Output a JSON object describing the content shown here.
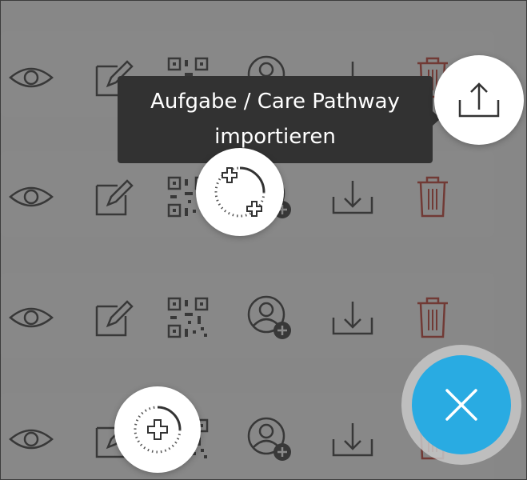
{
  "tooltip": {
    "line1": "Aufgabe / Care Pathway",
    "line2": "importieren"
  },
  "rows": [
    {
      "name": "row-1"
    },
    {
      "name": "row-2"
    },
    {
      "name": "row-3"
    },
    {
      "name": "row-4"
    }
  ],
  "row_actions": [
    "view-icon",
    "edit-icon",
    "qr-code-icon",
    "add-user-icon",
    "download-icon",
    "delete-icon"
  ],
  "colors": {
    "overlay": "#3c3c3c",
    "tooltip_bg": "#323232",
    "fab": "#29abe2",
    "delete": "#c0392b",
    "icon": "#333333"
  },
  "speed_dial": [
    {
      "name": "import-action-icon"
    },
    {
      "name": "loading-add-icon"
    },
    {
      "name": "loading-add-small-icon"
    }
  ],
  "fab": {
    "icon": "close-icon"
  }
}
